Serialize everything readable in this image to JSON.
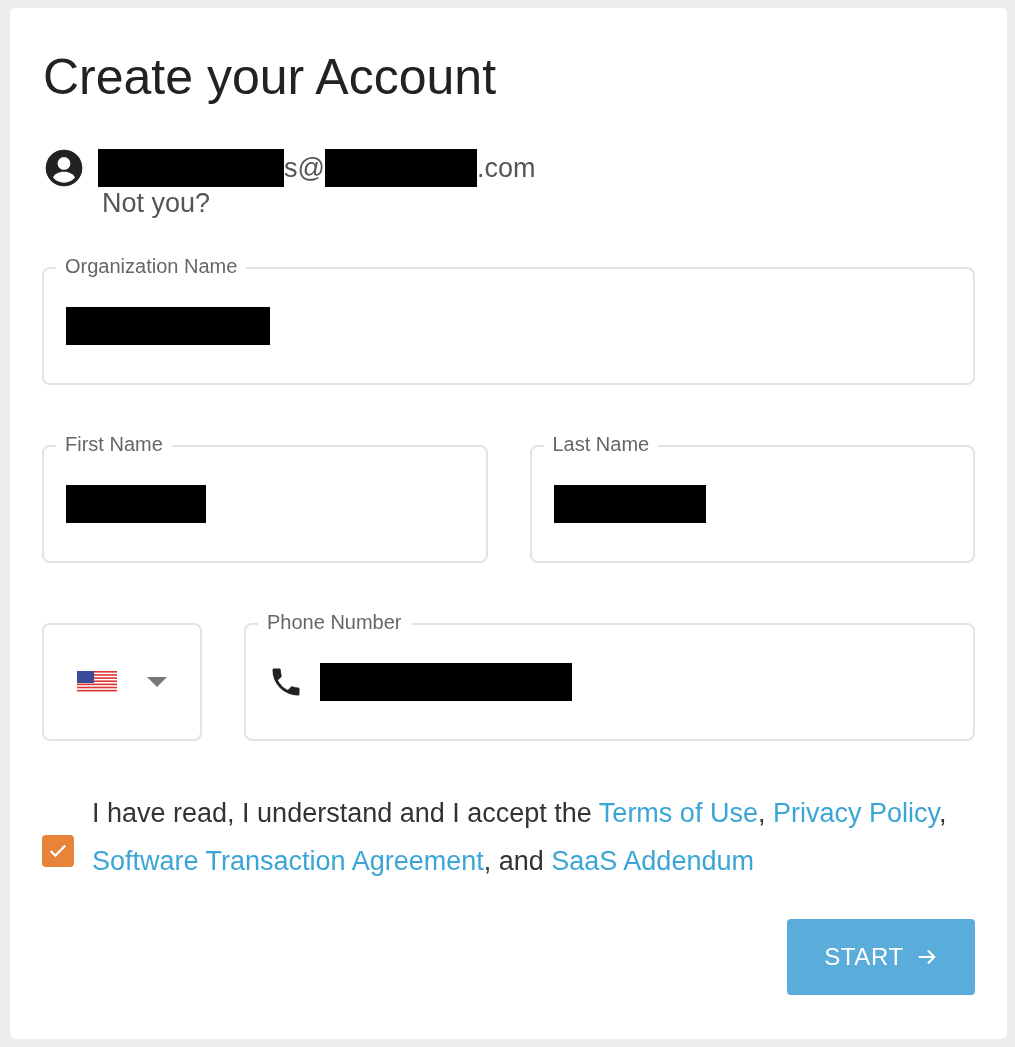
{
  "title": "Create your Account",
  "email": [
    {
      "kind": "redacted"
    },
    {
      "kind": "text",
      "text": "s@"
    },
    {
      "kind": "redacted"
    },
    {
      "kind": "text",
      "text": ".com"
    }
  ],
  "not_you": "Not you?",
  "organization": {
    "label": "Organization Name",
    "value_redacted": true
  },
  "first_name": {
    "label": "First Name",
    "value_redacted": true
  },
  "last_name": {
    "label": "Last Name",
    "value_redacted": true
  },
  "phone": {
    "label": "Phone Number",
    "value_redacted": true
  },
  "terms": {
    "checked": true,
    "segments": [
      {
        "kind": "text",
        "text": "I have read, I understand and I accept the "
      },
      {
        "kind": "link",
        "text": "Terms of Use"
      },
      {
        "kind": "text",
        "text": ", "
      },
      {
        "kind": "link",
        "text": "Privacy Policy"
      },
      {
        "kind": "text",
        "text": ", "
      },
      {
        "kind": "link",
        "text": "Software Transaction Agreement"
      },
      {
        "kind": "text",
        "text": ", and "
      },
      {
        "kind": "link",
        "text": "SaaS Addendum"
      }
    ]
  },
  "start_button": "START"
}
